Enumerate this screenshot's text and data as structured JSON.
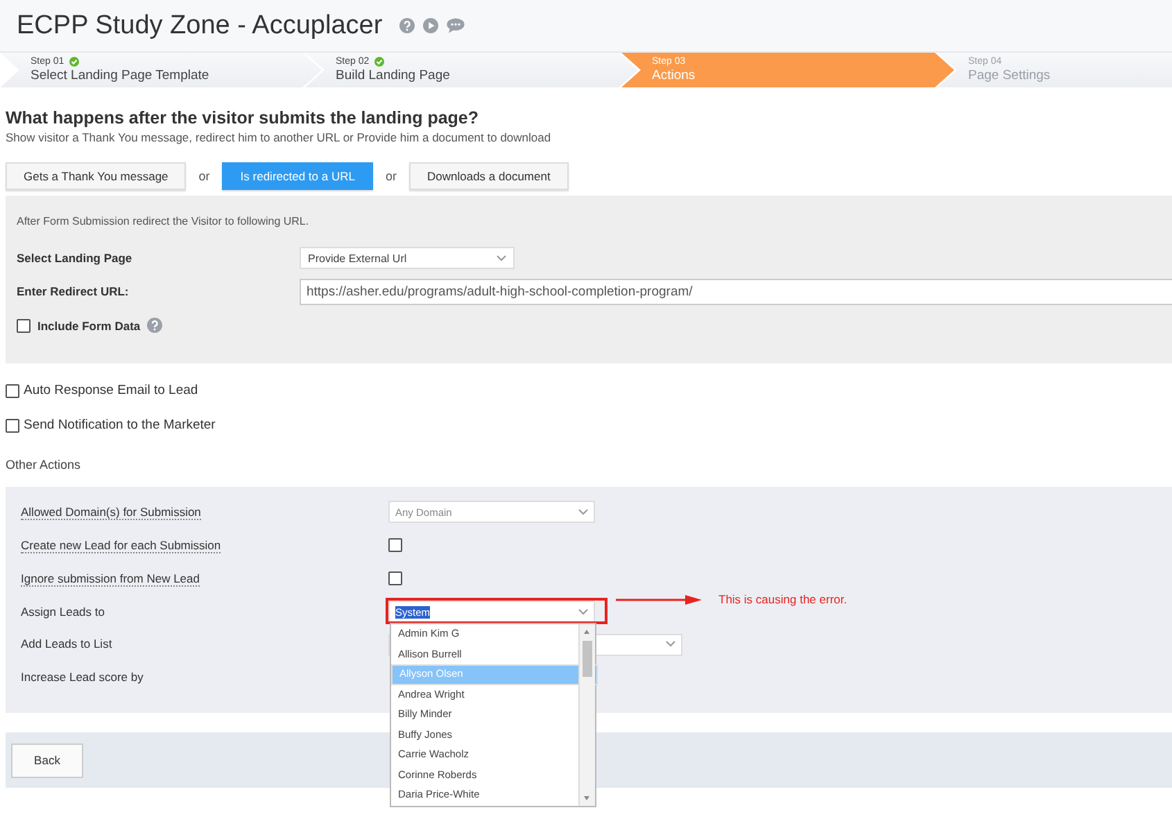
{
  "header": {
    "title": "ECPP Study Zone - Accuplacer"
  },
  "steps": [
    {
      "number": "Step 01",
      "name": "Select Landing Page Template",
      "completed": true,
      "selected": false,
      "disabled": false
    },
    {
      "number": "Step 02",
      "name": "Build Landing Page",
      "completed": true,
      "selected": false,
      "disabled": false
    },
    {
      "number": "Step 03",
      "name": "Actions",
      "completed": false,
      "selected": true,
      "disabled": false
    },
    {
      "number": "Step 04",
      "name": "Page Settings",
      "completed": false,
      "selected": false,
      "disabled": true
    }
  ],
  "question": {
    "title": "What happens after the visitor submits the landing page?",
    "subtitle": "Show visitor a Thank You message, redirect him to another URL or Provide him a document to download"
  },
  "outcome_options": [
    {
      "label": "Gets a Thank You message",
      "selected": false
    },
    {
      "label": "Is redirected to a URL",
      "selected": true
    },
    {
      "label": "Downloads a document",
      "selected": false
    }
  ],
  "separators": [
    "or",
    "or"
  ],
  "redirect_panel": {
    "note": "After Form Submission redirect the Visitor to following URL.",
    "fields": [
      {
        "kind": "select",
        "label": "Select Landing Page",
        "value": "Provide External Url"
      },
      {
        "kind": "input",
        "label": "Enter Redirect URL:",
        "value": "https://asher.edu/programs/adult-high-school-completion-program/"
      }
    ],
    "include_form_data": {
      "label": "Include Form Data",
      "checked": false
    }
  },
  "notifications": [
    {
      "label": "Auto Response Email to Lead",
      "checked": false
    },
    {
      "label": "Send Notification to the Marketer",
      "checked": false
    }
  ],
  "other_actions": {
    "title": "Other Actions",
    "rows": [
      {
        "kind": "select",
        "label": "Allowed Domain(s) for Submission",
        "tooltip": true,
        "value": "Any Domain",
        "disabled": true,
        "expanded": false
      },
      {
        "kind": "checkbox",
        "label": "Create new Lead for each Submission",
        "tooltip": true,
        "checked": false
      },
      {
        "kind": "checkbox",
        "label": "Ignore submission from New Lead",
        "tooltip": true,
        "checked": false
      },
      {
        "kind": "select",
        "label": "Assign Leads to",
        "tooltip": false,
        "value": "System",
        "disabled": false,
        "expanded": true,
        "options": [
          {
            "label": "Admin Kim G",
            "selected": false
          },
          {
            "label": "Allison Burrell",
            "selected": false
          },
          {
            "label": "Allyson Olsen",
            "selected": true
          },
          {
            "label": "Andrea Wright",
            "selected": false
          },
          {
            "label": "Billy Minder",
            "selected": false
          },
          {
            "label": "Buffy Jones",
            "selected": false
          },
          {
            "label": "Carrie Wacholz",
            "selected": false
          },
          {
            "label": "Corinne Roberds",
            "selected": false
          },
          {
            "label": "Daria Price-White",
            "selected": false
          }
        ]
      },
      {
        "kind": "select",
        "label": "Add Leads to List",
        "tooltip": false
      },
      {
        "kind": "text",
        "label": "Increase Lead score by",
        "tooltip": false
      }
    ]
  },
  "annotation": {
    "text": "This is causing the error."
  },
  "footer": {
    "back_button": "Back"
  }
}
